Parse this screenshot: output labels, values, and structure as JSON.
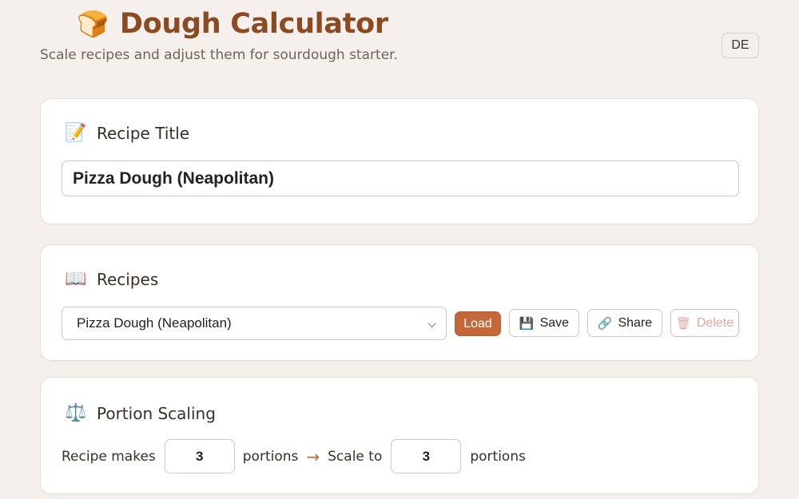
{
  "header": {
    "logo_emoji": "🍞",
    "title": "Dough Calculator",
    "subtitle": "Scale recipes and adjust them for sourdough starter.",
    "language_button": "DE"
  },
  "recipe_title_card": {
    "icon_emoji": "📝",
    "heading": "Recipe Title",
    "input_value": "Pizza Dough (Neapolitan)"
  },
  "recipes_card": {
    "icon_emoji": "📖",
    "heading": "Recipes",
    "selected_recipe": "Pizza Dough (Neapolitan)",
    "chevron": "⌵",
    "load_label": "Load",
    "save_icon": "💾",
    "save_label": "Save",
    "share_icon": "🔗",
    "share_label": "Share",
    "delete_icon": "🗑",
    "delete_label": "Delete"
  },
  "portion_card": {
    "icon_emoji": "⚖️",
    "heading": "Portion Scaling",
    "recipe_makes_label": "Recipe makes",
    "recipe_makes_value": "3",
    "portions_label_1": "portions",
    "arrow": "→",
    "scale_to_label": "Scale to",
    "scale_to_value": "3",
    "portions_label_2": "portions"
  },
  "colors": {
    "accent": "#c4683a",
    "title_brown": "#8b4a21",
    "background": "#f5f0eb"
  }
}
